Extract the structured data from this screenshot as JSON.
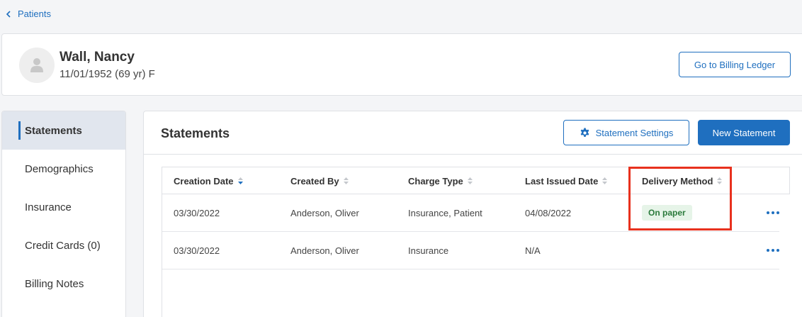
{
  "breadcrumb": {
    "label": "Patients"
  },
  "patient": {
    "name": "Wall, Nancy",
    "info": "11/01/1952 (69 yr) F",
    "ledger_button": "Go to Billing Ledger"
  },
  "sidebar": {
    "items": [
      {
        "label": "Statements",
        "active": true
      },
      {
        "label": "Demographics"
      },
      {
        "label": "Insurance"
      },
      {
        "label": "Credit Cards (0)"
      },
      {
        "label": "Billing Notes"
      }
    ]
  },
  "main": {
    "title": "Statements",
    "settings_button": "Statement Settings",
    "new_button": "New Statement"
  },
  "table": {
    "columns": [
      "Creation Date",
      "Created By",
      "Charge Type",
      "Last Issued Date",
      "Delivery Method"
    ],
    "sorted_column": "Creation Date",
    "rows": [
      {
        "creation_date": "03/30/2022",
        "created_by": "Anderson, Oliver",
        "charge_type": "Insurance, Patient",
        "last_issued": "04/08/2022",
        "delivery": "On paper"
      },
      {
        "creation_date": "03/30/2022",
        "created_by": "Anderson, Oliver",
        "charge_type": "Insurance",
        "last_issued": "N/A",
        "delivery": ""
      }
    ]
  },
  "colors": {
    "accent": "#1f6fbf",
    "highlight": "#e8311e",
    "badge_bg": "#e6f4e8",
    "badge_text": "#2a7a3b"
  }
}
